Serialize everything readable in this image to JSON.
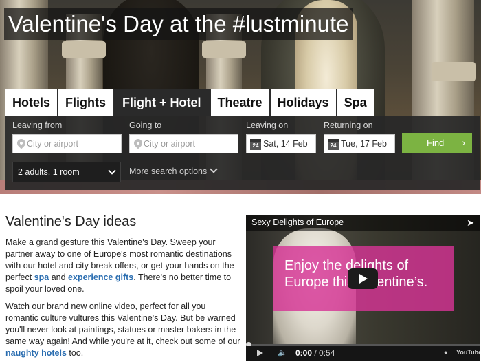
{
  "hero": {
    "title": "Valentine's Day at the #lustminute"
  },
  "tabs": [
    {
      "label": "Hotels",
      "active": false
    },
    {
      "label": "Flights",
      "active": false
    },
    {
      "label": "Flight + Hotel",
      "active": true
    },
    {
      "label": "Theatre",
      "active": false
    },
    {
      "label": "Holidays",
      "active": false
    },
    {
      "label": "Spa",
      "active": false
    }
  ],
  "search": {
    "leaving_from_label": "Leaving from",
    "leaving_from_placeholder": "City or airport",
    "going_to_label": "Going to",
    "going_to_placeholder": "City or airport",
    "leaving_on_label": "Leaving on",
    "leaving_on_value": "Sat, 14 Feb",
    "returning_on_label": "Returning on",
    "returning_on_value": "Tue, 17 Feb",
    "calendar_day": "24",
    "find_label": "Find",
    "guests_value": "2 adults, 1 room",
    "more_options": "More search options"
  },
  "content": {
    "heading": "Valentine's Day ideas",
    "p1_before": "Make a grand gesture this Valentine's Day. Sweep your partner away to one of Europe's most romantic destinations with our hotel and city break offers, or get your hands on the perfect ",
    "p1_link1": "spa",
    "p1_middle": " and ",
    "p1_link2": "experience gifts",
    "p1_after": ". There's no better time to spoil your loved one.",
    "p2_before": "Watch our brand new online video, perfect for all you romantic culture vultures this Valentine's Day. But be warned you'll never look at paintings, statues or master bakers in the same way again! And while you're at it, check out some of our ",
    "p2_link": "naughty hotels",
    "p2_after": " too."
  },
  "video": {
    "title": "Sexy Delights of Europe",
    "overlay_text": "Enjoy the delights of Europe this Valentine’s.",
    "current_time": "0:00",
    "separator": " / ",
    "duration": "0:54",
    "youtube_label": "YouTube",
    "progress_fraction": 0.0
  }
}
